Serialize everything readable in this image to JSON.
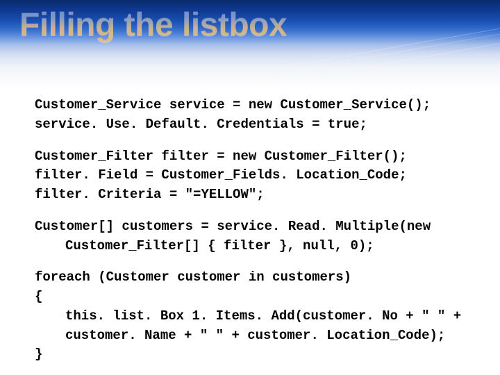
{
  "title": "Filling the listbox",
  "code": {
    "l1": "Customer_Service service = new Customer_Service();",
    "l2": "service. Use. Default. Credentials = true;",
    "l3": "Customer_Filter filter = new Customer_Filter();",
    "l4": "filter. Field = Customer_Fields. Location_Code;",
    "l5": "filter. Criteria = \"=YELLOW\";",
    "l6a": "Customer[] customers = service. Read. Multiple(new",
    "l6b": "Customer_Filter[] { filter }, null, 0);",
    "l7": "foreach (Customer customer in customers)",
    "l8": "{",
    "l9a": "this. list. Box 1. Items. Add(customer. No + \" \" +",
    "l9b": "customer. Name + \" \" + customer. Location_Code);",
    "l10": "}"
  }
}
